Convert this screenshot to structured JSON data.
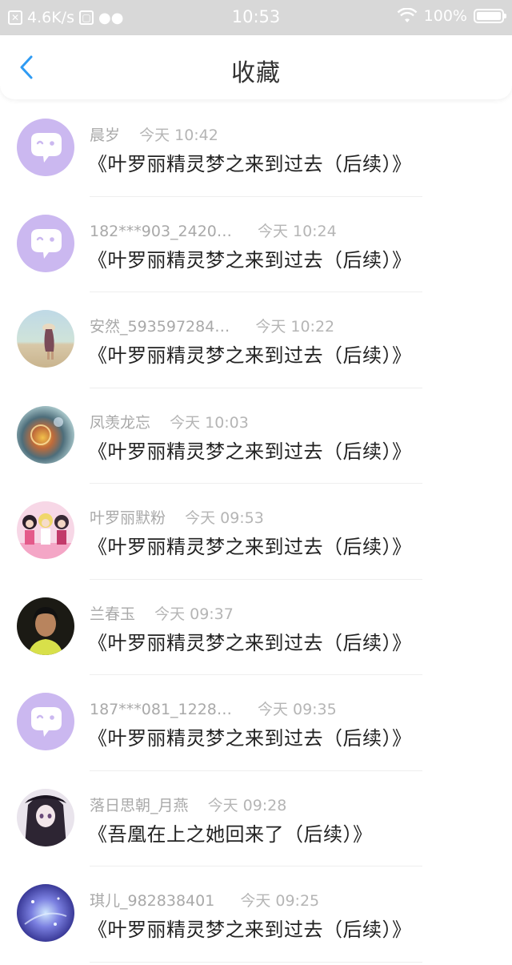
{
  "status_bar": {
    "speed": "4.6K/s",
    "time": "10:53",
    "battery": "100%",
    "battery_level": 1.0
  },
  "nav": {
    "title": "收藏"
  },
  "items": [
    {
      "name": "晨岁",
      "time": "今天 10:42",
      "title": "《叶罗丽精灵梦之来到过去（后续）》",
      "avatar": "default-chat-avatar"
    },
    {
      "name": "182***903_2420…",
      "time": "今天 10:24",
      "title": "《叶罗丽精灵梦之来到过去（后续）》",
      "avatar": "default-chat-avatar"
    },
    {
      "name": "安然_593597284…",
      "time": "今天 10:22",
      "title": "《叶罗丽精灵梦之来到过去（后续）》",
      "avatar": "beach-girl-photo"
    },
    {
      "name": "凤羡龙忘",
      "time": "今天 10:03",
      "title": "《叶罗丽精灵梦之来到过去（后续）》",
      "avatar": "crystal-orb-photo"
    },
    {
      "name": "叶罗丽默粉",
      "time": "今天 09:53",
      "title": "《叶罗丽精灵梦之来到过去（后续）》",
      "avatar": "anime-dolls-photo"
    },
    {
      "name": "兰春玉",
      "time": "今天 09:37",
      "title": "《叶罗丽精灵梦之来到过去（后续）》",
      "avatar": "portrait-photo"
    },
    {
      "name": "187***081_1228…",
      "time": "今天 09:35",
      "title": "《叶罗丽精灵梦之来到过去（后续）》",
      "avatar": "default-chat-avatar"
    },
    {
      "name": "落日思朝_月燕",
      "time": "今天 09:28",
      "title": "《吾凰在上之她回来了（后续）》",
      "avatar": "anime-girl-dark"
    },
    {
      "name": "琪儿_982838401",
      "time": "今天 09:25",
      "title": "《叶罗丽精灵梦之来到过去（后续）》",
      "avatar": "galaxy-photo"
    }
  ],
  "colors": {
    "accent": "#2f9bf3",
    "default_avatar_bg": "#cbb8f0",
    "status_bar_bg": "#d8d8d8"
  }
}
